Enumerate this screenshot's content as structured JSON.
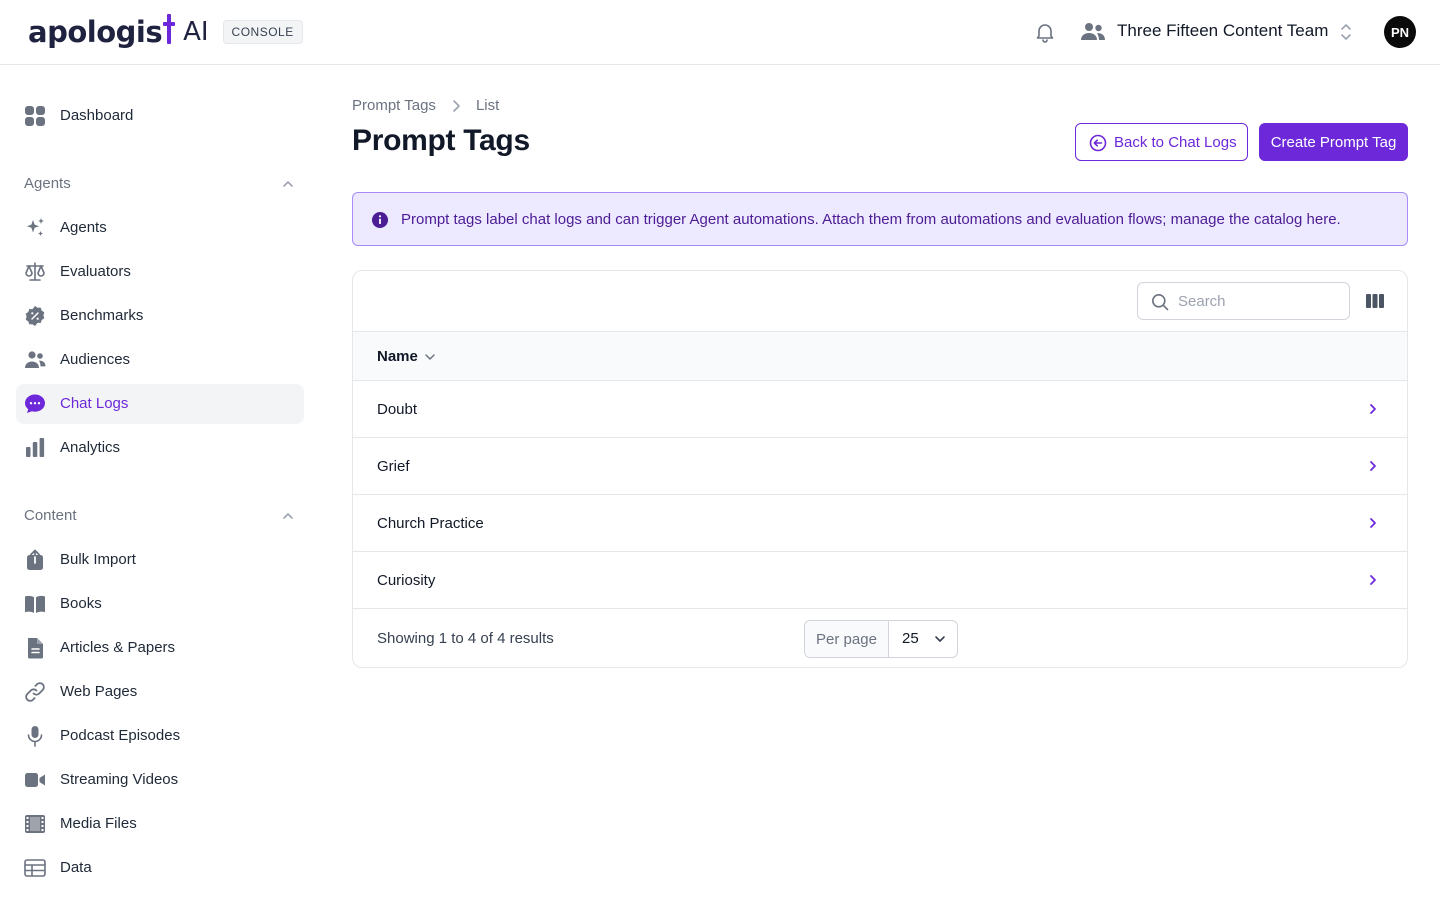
{
  "header": {
    "logo_word": "apologis",
    "logo_suffix": "AI",
    "console_badge": "CONSOLE",
    "team_name": "Three Fifteen Content Team",
    "avatar_initials": "PN"
  },
  "sidebar": {
    "dashboard": {
      "label": "Dashboard",
      "icon": "dashboard-icon"
    },
    "agents_section": {
      "title": "Agents",
      "items": [
        {
          "label": "Agents",
          "icon": "sparkles-icon"
        },
        {
          "label": "Evaluators",
          "icon": "scale-icon"
        },
        {
          "label": "Benchmarks",
          "icon": "badge-percent-icon"
        },
        {
          "label": "Audiences",
          "icon": "users-icon"
        },
        {
          "label": "Chat Logs",
          "icon": "chat-bubble-icon",
          "active": true
        },
        {
          "label": "Analytics",
          "icon": "bar-chart-icon"
        }
      ]
    },
    "content_section": {
      "title": "Content",
      "items": [
        {
          "label": "Bulk Import",
          "icon": "upload-icon"
        },
        {
          "label": "Books",
          "icon": "book-icon"
        },
        {
          "label": "Articles & Papers",
          "icon": "document-icon"
        },
        {
          "label": "Web Pages",
          "icon": "link-icon"
        },
        {
          "label": "Podcast Episodes",
          "icon": "microphone-icon"
        },
        {
          "label": "Streaming Videos",
          "icon": "video-camera-icon"
        },
        {
          "label": "Media Files",
          "icon": "film-icon"
        },
        {
          "label": "Data",
          "icon": "table-icon"
        }
      ]
    }
  },
  "breadcrumb": [
    "Prompt Tags",
    "List"
  ],
  "page_title": "Prompt Tags",
  "actions": {
    "back_label": "Back to Chat Logs",
    "create_label": "Create Prompt Tag"
  },
  "info_banner": "Prompt tags label chat logs and can trigger Agent automations. Attach them from automations and evaluation flows; manage the catalog here.",
  "table": {
    "search_placeholder": "Search",
    "column_header": "Name",
    "rows": [
      "Doubt",
      "Grief",
      "Church Practice",
      "Curiosity"
    ],
    "summary": "Showing 1 to 4 of 4 results",
    "per_page_label": "Per page",
    "per_page_value": "25"
  },
  "colors": {
    "accent": "#6d28d9",
    "banner_bg": "#ede9fe",
    "banner_border": "#a78bfa",
    "icon_gray": "#6b7280"
  }
}
